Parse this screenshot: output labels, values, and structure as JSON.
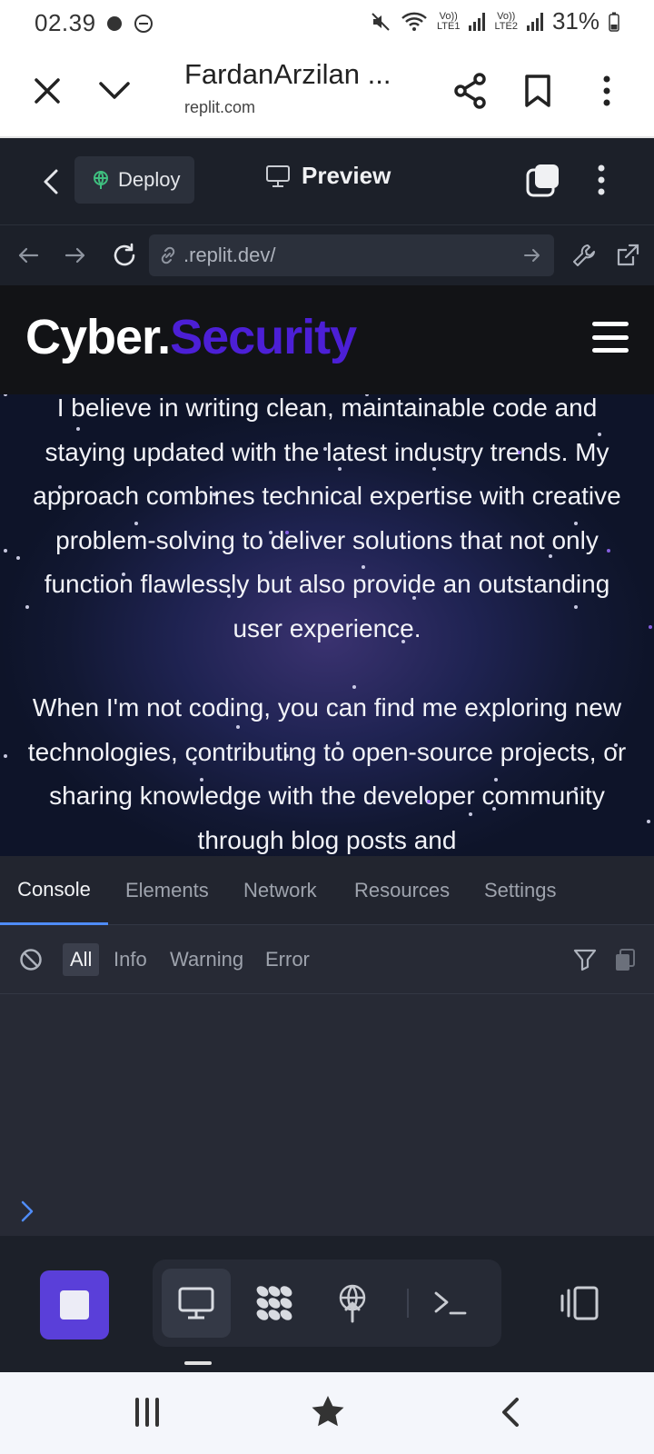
{
  "status_bar": {
    "time": "02.39",
    "sim1": "Vo))\nLTE1",
    "sim2": "Vo))\nLTE2",
    "battery": "31%"
  },
  "browser": {
    "page_title": "FardanArzilan ...",
    "domain": "replit.com"
  },
  "replit": {
    "deploy_label": "Deploy",
    "preview_label": "Preview",
    "url": ".replit.dev/"
  },
  "website": {
    "brand_part1": "Cyber.",
    "brand_part2": "Security",
    "paragraph1": "I believe in writing clean, maintainable code and staying updated with the latest industry trends. My approach combines technical expertise with creative problem-solving to deliver solutions that not only function flawlessly but also provide an outstanding user experience.",
    "paragraph2": "When I'm not coding, you can find me exploring new technologies, contributing to open-source projects, or sharing knowledge with the developer community through blog posts and"
  },
  "devtools": {
    "tabs": [
      "Console",
      "Elements",
      "Network",
      "Resources",
      "Settings"
    ],
    "active_tab": "Console",
    "filters": [
      "All",
      "Info",
      "Warning",
      "Error"
    ],
    "active_filter": "All",
    "prompt_symbol": ">"
  },
  "colors": {
    "brand_accent": "#4c1fd6",
    "replit_bg": "#1c2029",
    "devtools_tab_accent": "#4f8cf7",
    "stop_button": "#5a3fd9"
  }
}
